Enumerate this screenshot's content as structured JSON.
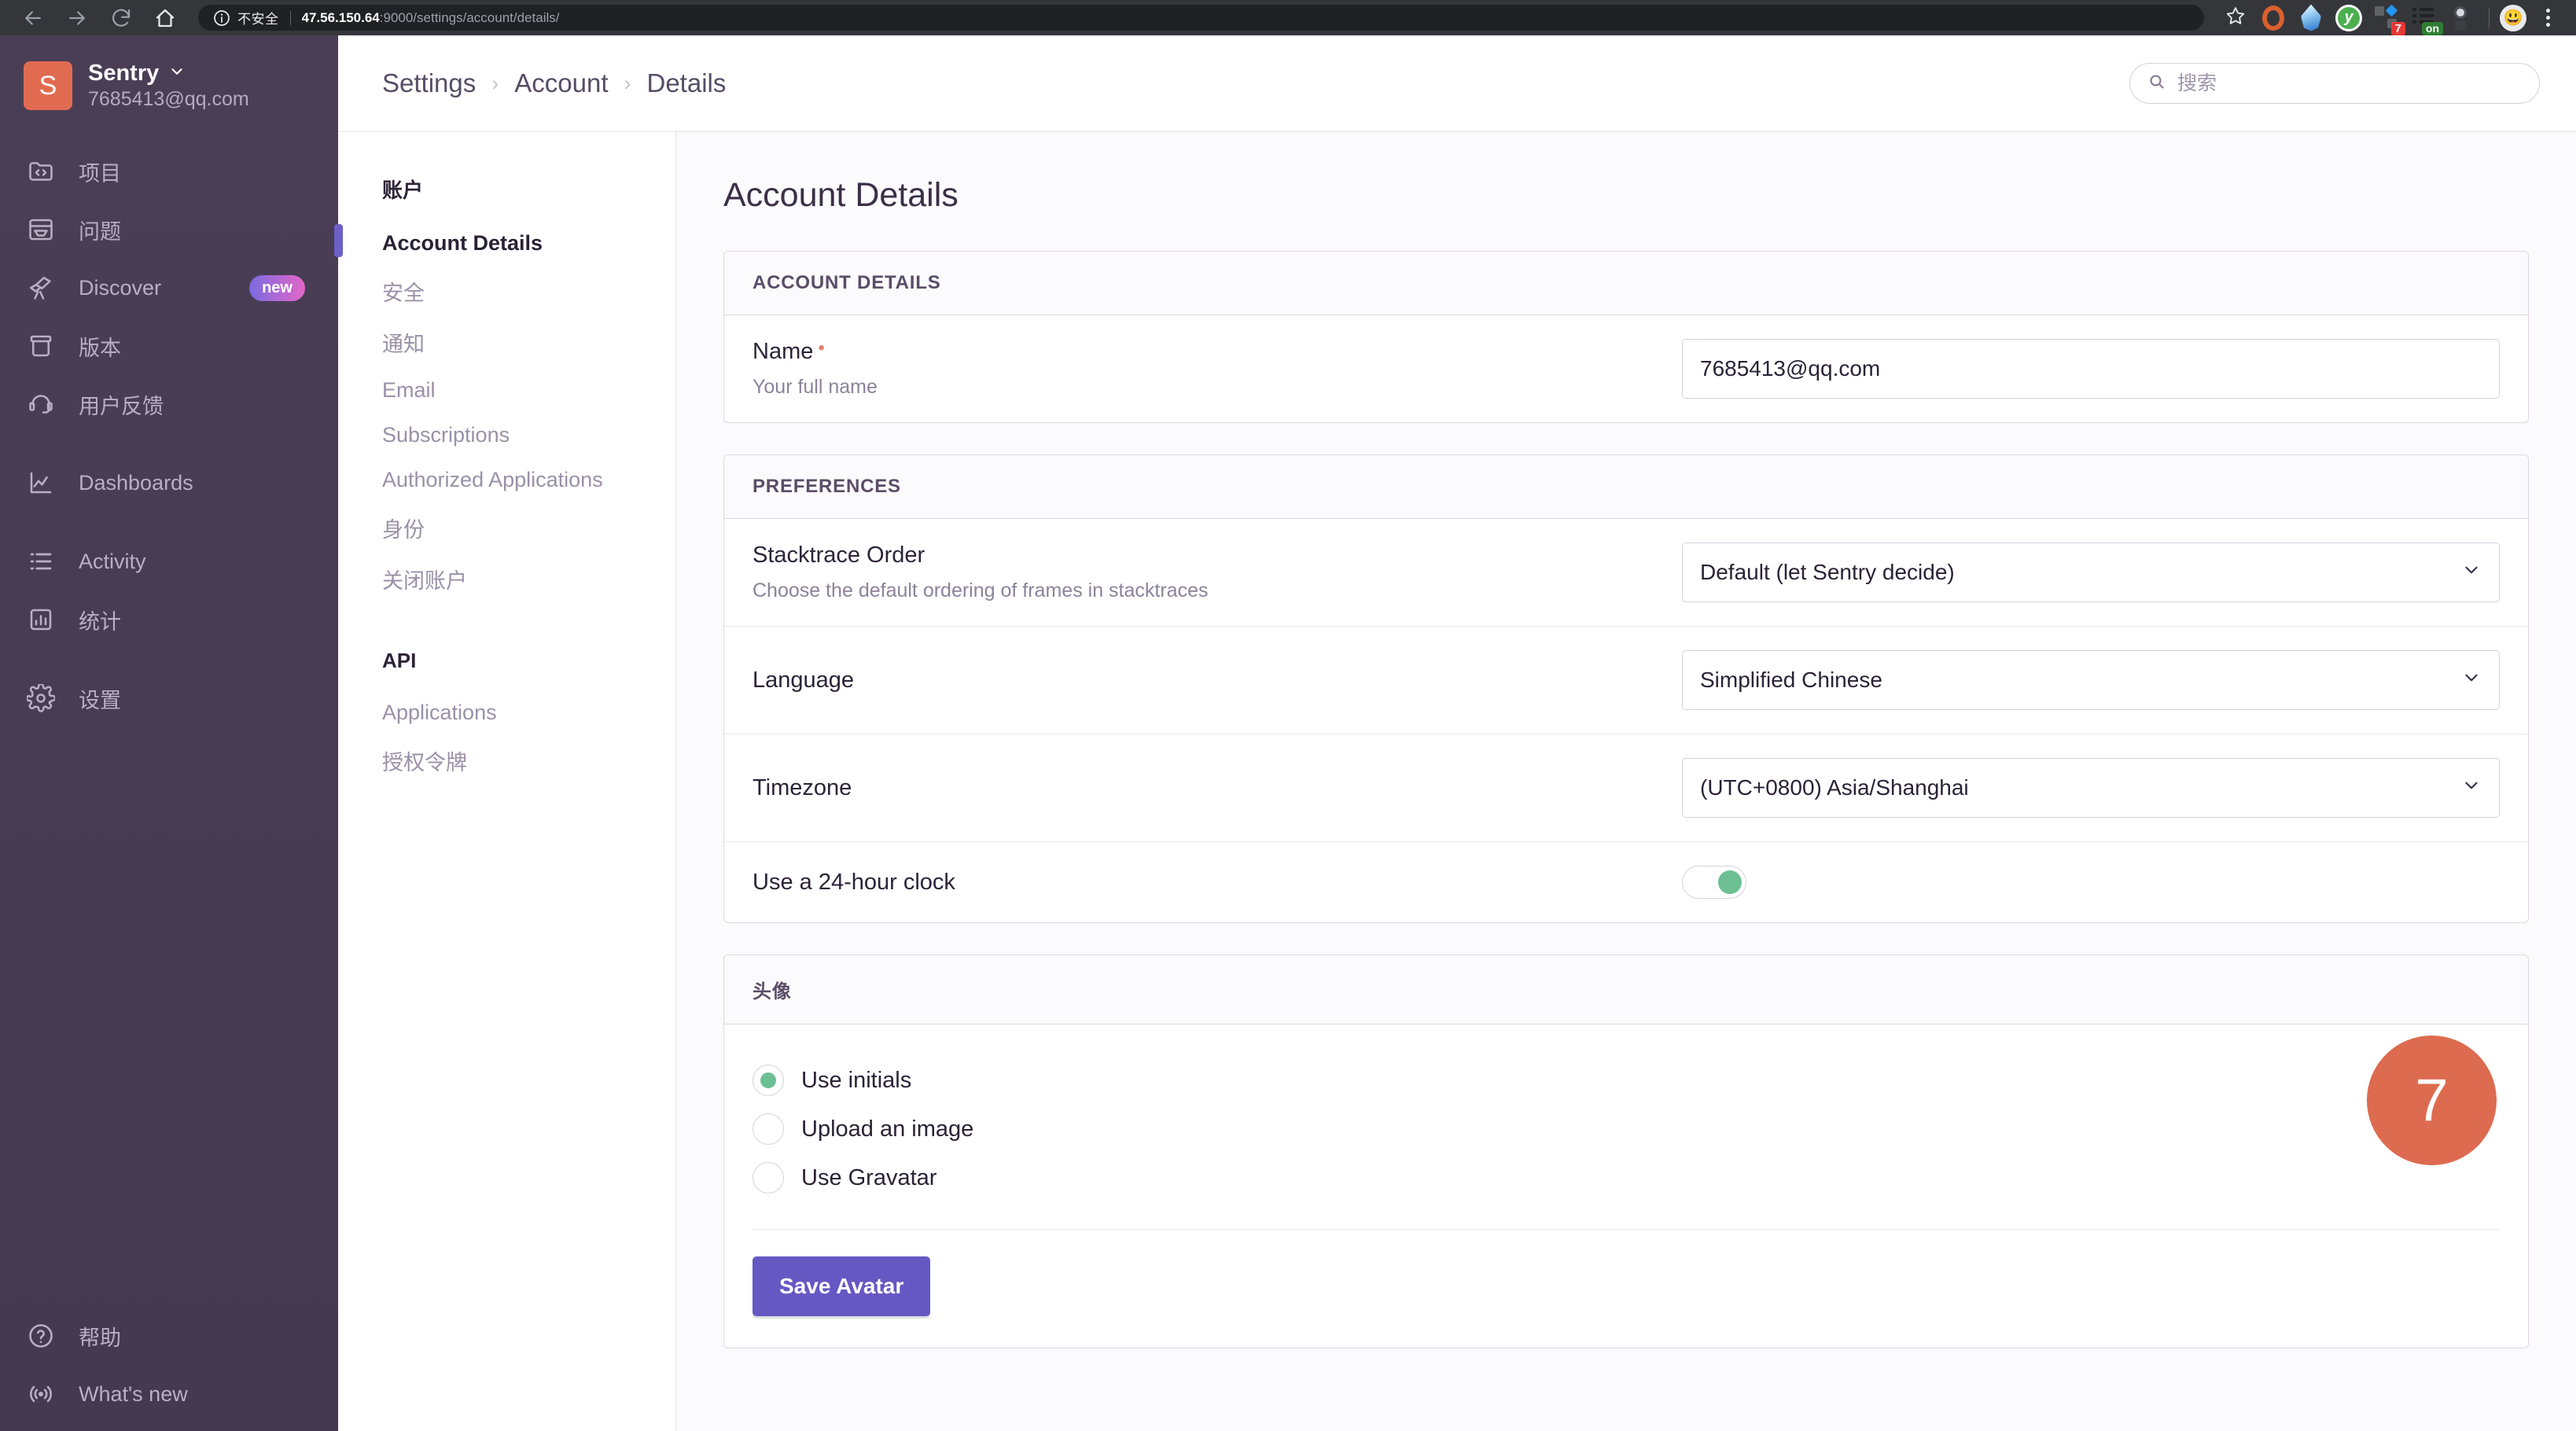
{
  "browser": {
    "back_icon": "back-arrow-icon",
    "forward_icon": "forward-arrow-icon",
    "reload_icon": "reload-icon",
    "home_icon": "home-icon",
    "security_label": "不安全",
    "url_host": "47.56.150.64",
    "url_rest": ":9000/settings/account/details/",
    "bookmark_icon": "star-icon",
    "extensions": [
      {
        "name": "opera-gx-extension-icon",
        "badge": ""
      },
      {
        "name": "water-drop-extension-icon",
        "badge": ""
      },
      {
        "name": "youdao-extension-icon",
        "glyph": "y",
        "badge": ""
      },
      {
        "name": "grid-extension-icon",
        "badge": "7"
      },
      {
        "name": "list-extension-icon",
        "badge": "on"
      },
      {
        "name": "magnifier-extension-icon",
        "badge": ""
      }
    ],
    "profile_icon": "profile-avatar-icon",
    "menu_icon": "kebab-menu-icon"
  },
  "sidebar": {
    "org_initial": "S",
    "org_name": "Sentry",
    "org_email": "7685413@qq.com",
    "dropdown_icon": "chevron-down-icon",
    "items": [
      {
        "label": "项目",
        "icon": "projects-icon",
        "badge": ""
      },
      {
        "label": "问题",
        "icon": "issues-icon",
        "badge": ""
      },
      {
        "label": "Discover",
        "icon": "discover-telescope-icon",
        "badge": "new"
      },
      {
        "label": "版本",
        "icon": "releases-icon",
        "badge": ""
      },
      {
        "label": "用户反馈",
        "icon": "user-feedback-icon",
        "badge": ""
      }
    ],
    "items_group2": [
      {
        "label": "Dashboards",
        "icon": "dashboards-chart-icon",
        "badge": ""
      }
    ],
    "items_group3": [
      {
        "label": "Activity",
        "icon": "activity-list-icon",
        "badge": ""
      },
      {
        "label": "统计",
        "icon": "stats-bar-icon",
        "badge": ""
      }
    ],
    "items_group4": [
      {
        "label": "设置",
        "icon": "settings-gear-icon",
        "badge": ""
      }
    ],
    "bottom_items": [
      {
        "label": "帮助",
        "icon": "help-question-icon"
      },
      {
        "label": "What's new",
        "icon": "broadcast-icon"
      }
    ]
  },
  "topbar": {
    "breadcrumbs": [
      "Settings",
      "Account",
      "Details"
    ],
    "crumb_separator": "›",
    "search_icon": "search-icon",
    "search_placeholder": "搜索",
    "search_value": ""
  },
  "settings_nav": {
    "heading_account": "账户",
    "account_items": [
      {
        "label": "Account Details",
        "active": true
      },
      {
        "label": "安全",
        "active": false
      },
      {
        "label": "通知",
        "active": false
      },
      {
        "label": "Email",
        "active": false
      },
      {
        "label": "Subscriptions",
        "active": false
      },
      {
        "label": "Authorized Applications",
        "active": false
      },
      {
        "label": "身份",
        "active": false
      },
      {
        "label": "关闭账户",
        "active": false
      }
    ],
    "heading_api": "API",
    "api_items": [
      {
        "label": "Applications",
        "active": false
      },
      {
        "label": "授权令牌",
        "active": false
      }
    ]
  },
  "content": {
    "page_title": "Account Details",
    "account_panel": {
      "header": "ACCOUNT DETAILS",
      "name_label": "Name",
      "name_required_marker": "•",
      "name_help": "Your full name",
      "name_value": "7685413@qq.com",
      "name_placeholder": "Your full name"
    },
    "preferences_panel": {
      "header": "PREFERENCES",
      "rows": [
        {
          "label": "Stacktrace Order",
          "help": "Choose the default ordering of frames in stacktraces",
          "control": "select",
          "value": "Default (let Sentry decide)"
        },
        {
          "label": "Language",
          "help": "",
          "control": "select",
          "value": "Simplified Chinese"
        },
        {
          "label": "Timezone",
          "help": "",
          "control": "select",
          "value": "(UTC+0800) Asia/Shanghai"
        },
        {
          "label": "Use a 24-hour clock",
          "help": "",
          "control": "toggle",
          "value": "on"
        }
      ]
    },
    "avatar_panel": {
      "header": "头像",
      "options": [
        {
          "label": "Use initials",
          "selected": true
        },
        {
          "label": "Upload an image",
          "selected": false
        },
        {
          "label": "Use Gravatar",
          "selected": false
        }
      ],
      "preview_initial": "7",
      "save_label": "Save Avatar"
    }
  },
  "colors": {
    "accent_purple": "#6c5fc7",
    "avatar_orange": "#dd6b4f",
    "toggle_green": "#6cbf93",
    "sidebar_bg": "#4a3e56",
    "badge_new_from": "#7b6ae0",
    "badge_new_to": "#e367c9"
  }
}
